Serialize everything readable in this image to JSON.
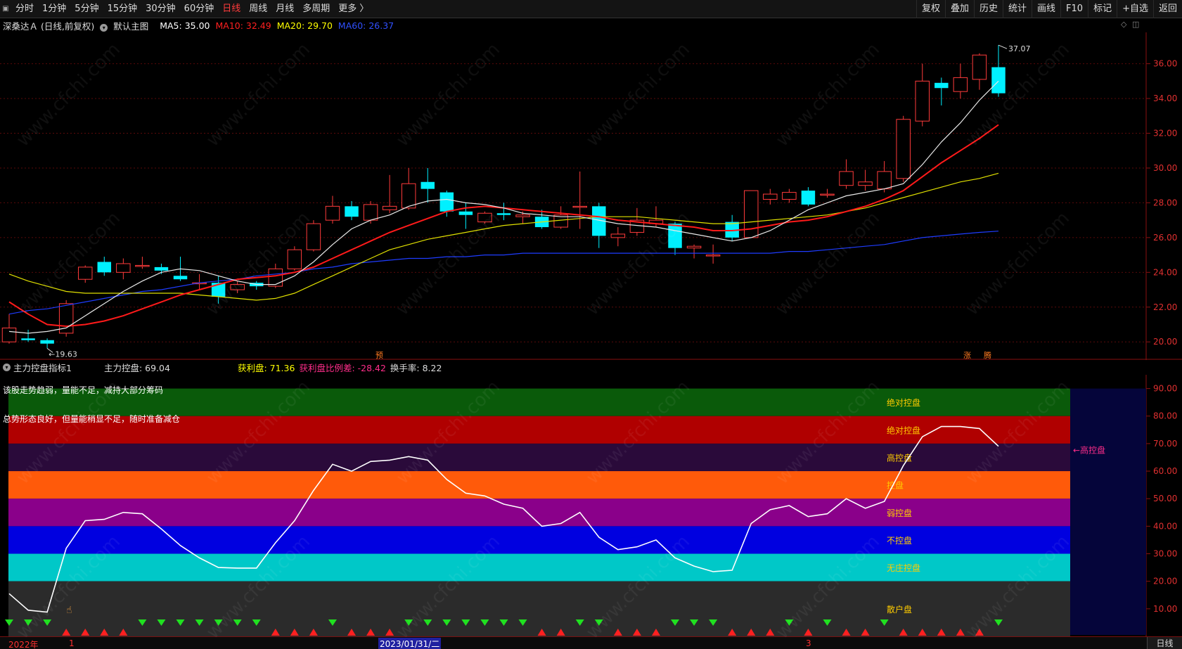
{
  "toolbar": {
    "left_items": [
      "分时",
      "1分钟",
      "5分钟",
      "15分钟",
      "30分钟",
      "60分钟",
      "日线",
      "周线",
      "月线",
      "多周期",
      "更多 〉"
    ],
    "active_index": 6,
    "right_items": [
      "复权",
      "叠加",
      "历史",
      "统计",
      "画线",
      "F10",
      "标记",
      "+自选",
      "返回"
    ]
  },
  "info": {
    "stock": "深桑达Ａ (日线,前复权)",
    "main_chart": "默认主图",
    "ma5": "MA5: 35.00",
    "ma10": "MA10: 32.49",
    "ma20": "MA20: 29.70",
    "ma60": "MA60: 26.37"
  },
  "chart_data": {
    "type": "candlestick",
    "y_ticks": [
      "36.00",
      "34.00",
      "32.00",
      "30.00",
      "28.00",
      "26.00",
      "24.00",
      "22.00",
      "20.00"
    ],
    "ylim": [
      19.2,
      37.4
    ],
    "high_label": "37.07",
    "low_label": "19.63",
    "markers": {
      "yu": "预",
      "zhang": "涨",
      "teng": "腾"
    },
    "candles": [
      {
        "o": 20.0,
        "h": 21.6,
        "l": 19.9,
        "c": 20.8
      },
      {
        "o": 20.2,
        "h": 20.7,
        "l": 20.0,
        "c": 20.1
      },
      {
        "o": 20.1,
        "h": 20.2,
        "l": 19.63,
        "c": 19.9
      },
      {
        "o": 20.5,
        "h": 22.4,
        "l": 20.3,
        "c": 22.2
      },
      {
        "o": 23.6,
        "h": 24.4,
        "l": 23.4,
        "c": 24.3
      },
      {
        "o": 24.6,
        "h": 24.9,
        "l": 23.8,
        "c": 24.0
      },
      {
        "o": 24.0,
        "h": 24.8,
        "l": 23.6,
        "c": 24.5
      },
      {
        "o": 24.4,
        "h": 24.9,
        "l": 24.2,
        "c": 24.4
      },
      {
        "o": 24.3,
        "h": 24.5,
        "l": 23.9,
        "c": 24.1
      },
      {
        "o": 23.8,
        "h": 24.9,
        "l": 23.5,
        "c": 23.6
      },
      {
        "o": 23.4,
        "h": 23.9,
        "l": 23.0,
        "c": 23.4
      },
      {
        "o": 23.4,
        "h": 23.8,
        "l": 22.2,
        "c": 22.6
      },
      {
        "o": 23.0,
        "h": 23.5,
        "l": 22.8,
        "c": 23.3
      },
      {
        "o": 23.4,
        "h": 23.5,
        "l": 23.0,
        "c": 23.2
      },
      {
        "o": 23.2,
        "h": 24.5,
        "l": 23.1,
        "c": 24.2
      },
      {
        "o": 24.2,
        "h": 25.5,
        "l": 24.1,
        "c": 25.3
      },
      {
        "o": 25.3,
        "h": 27.0,
        "l": 25.2,
        "c": 26.8
      },
      {
        "o": 27.0,
        "h": 28.4,
        "l": 26.8,
        "c": 27.8
      },
      {
        "o": 27.8,
        "h": 28.1,
        "l": 27.0,
        "c": 27.2
      },
      {
        "o": 27.0,
        "h": 28.1,
        "l": 26.8,
        "c": 27.9
      },
      {
        "o": 27.6,
        "h": 29.6,
        "l": 27.4,
        "c": 27.8
      },
      {
        "o": 27.7,
        "h": 30.0,
        "l": 27.6,
        "c": 29.1
      },
      {
        "o": 29.2,
        "h": 30.0,
        "l": 28.0,
        "c": 28.8
      },
      {
        "o": 28.6,
        "h": 28.7,
        "l": 27.2,
        "c": 27.5
      },
      {
        "o": 27.5,
        "h": 28.0,
        "l": 26.5,
        "c": 27.3
      },
      {
        "o": 26.9,
        "h": 27.5,
        "l": 26.8,
        "c": 27.4
      },
      {
        "o": 27.4,
        "h": 28.0,
        "l": 27.0,
        "c": 27.3
      },
      {
        "o": 27.2,
        "h": 27.5,
        "l": 26.8,
        "c": 27.3
      },
      {
        "o": 27.2,
        "h": 27.6,
        "l": 26.5,
        "c": 26.6
      },
      {
        "o": 26.6,
        "h": 27.8,
        "l": 26.5,
        "c": 27.3
      },
      {
        "o": 27.8,
        "h": 29.8,
        "l": 26.5,
        "c": 27.8
      },
      {
        "o": 27.8,
        "h": 28.0,
        "l": 25.4,
        "c": 26.1
      },
      {
        "o": 26.0,
        "h": 26.6,
        "l": 25.5,
        "c": 26.2
      },
      {
        "o": 26.3,
        "h": 27.7,
        "l": 26.1,
        "c": 27.0
      },
      {
        "o": 26.8,
        "h": 27.8,
        "l": 26.6,
        "c": 27.0
      },
      {
        "o": 26.8,
        "h": 26.9,
        "l": 25.0,
        "c": 25.4
      },
      {
        "o": 25.4,
        "h": 25.6,
        "l": 24.8,
        "c": 25.5
      },
      {
        "o": 25.0,
        "h": 25.6,
        "l": 24.5,
        "c": 25.0
      },
      {
        "o": 26.9,
        "h": 27.3,
        "l": 25.8,
        "c": 26.0
      },
      {
        "o": 26.0,
        "h": 28.7,
        "l": 26.0,
        "c": 28.7
      },
      {
        "o": 28.2,
        "h": 28.8,
        "l": 27.9,
        "c": 28.5
      },
      {
        "o": 28.2,
        "h": 28.8,
        "l": 28.0,
        "c": 28.6
      },
      {
        "o": 28.7,
        "h": 28.9,
        "l": 27.8,
        "c": 27.9
      },
      {
        "o": 28.5,
        "h": 28.8,
        "l": 28.3,
        "c": 28.5
      },
      {
        "o": 29.0,
        "h": 30.5,
        "l": 28.8,
        "c": 29.8
      },
      {
        "o": 29.0,
        "h": 29.9,
        "l": 28.7,
        "c": 29.2
      },
      {
        "o": 28.8,
        "h": 30.4,
        "l": 28.6,
        "c": 29.8
      },
      {
        "o": 29.4,
        "h": 33.0,
        "l": 29.2,
        "c": 32.8
      },
      {
        "o": 32.7,
        "h": 36.0,
        "l": 32.4,
        "c": 35.0
      },
      {
        "o": 34.9,
        "h": 35.2,
        "l": 33.6,
        "c": 34.6
      },
      {
        "o": 34.4,
        "h": 36.0,
        "l": 34.0,
        "c": 35.2
      },
      {
        "o": 35.1,
        "h": 36.6,
        "l": 34.5,
        "c": 36.5
      },
      {
        "o": 35.8,
        "h": 37.07,
        "l": 34.1,
        "c": 34.3
      }
    ],
    "ma5": [
      20.6,
      20.5,
      20.6,
      20.8,
      21.5,
      22.2,
      22.9,
      23.5,
      24.0,
      24.2,
      24.1,
      23.8,
      23.5,
      23.3,
      23.3,
      23.8,
      24.6,
      25.6,
      26.5,
      27.0,
      27.3,
      27.8,
      28.1,
      28.2,
      28.0,
      27.9,
      27.7,
      27.4,
      27.3,
      27.2,
      27.2,
      27.0,
      26.8,
      26.7,
      26.6,
      26.4,
      26.2,
      26.0,
      25.8,
      26.0,
      26.4,
      27.0,
      27.6,
      28.0,
      28.4,
      28.6,
      28.8,
      29.1,
      30.2,
      31.5,
      32.6,
      33.9,
      35.0
    ],
    "ma10": [
      22.3,
      21.6,
      21.0,
      20.9,
      21.0,
      21.2,
      21.5,
      21.9,
      22.3,
      22.7,
      23.0,
      23.3,
      23.6,
      23.7,
      23.8,
      24.0,
      24.3,
      24.8,
      25.3,
      25.8,
      26.3,
      26.7,
      27.1,
      27.5,
      27.7,
      27.8,
      27.7,
      27.6,
      27.5,
      27.4,
      27.3,
      27.2,
      27.0,
      26.9,
      26.8,
      26.7,
      26.6,
      26.4,
      26.4,
      26.5,
      26.7,
      26.9,
      27.0,
      27.2,
      27.5,
      27.8,
      28.2,
      28.7,
      29.5,
      30.3,
      31.0,
      31.7,
      32.49
    ],
    "ma20": [
      23.9,
      23.5,
      23.2,
      22.9,
      22.8,
      22.8,
      22.8,
      22.8,
      22.8,
      22.8,
      22.7,
      22.6,
      22.5,
      22.4,
      22.5,
      22.8,
      23.3,
      23.8,
      24.3,
      24.8,
      25.3,
      25.6,
      25.9,
      26.1,
      26.3,
      26.5,
      26.7,
      26.8,
      26.9,
      27.0,
      27.1,
      27.2,
      27.2,
      27.2,
      27.1,
      27.0,
      26.9,
      26.8,
      26.8,
      26.9,
      27.0,
      27.1,
      27.2,
      27.3,
      27.5,
      27.7,
      28.0,
      28.3,
      28.6,
      28.9,
      29.2,
      29.4,
      29.7
    ],
    "ma60": [
      21.6,
      21.8,
      21.9,
      22.1,
      22.3,
      22.5,
      22.7,
      22.9,
      23.0,
      23.2,
      23.4,
      23.5,
      23.6,
      23.8,
      23.9,
      24.0,
      24.2,
      24.3,
      24.5,
      24.6,
      24.7,
      24.8,
      24.8,
      24.9,
      24.9,
      25.0,
      25.0,
      25.1,
      25.1,
      25.1,
      25.1,
      25.1,
      25.1,
      25.1,
      25.1,
      25.1,
      25.1,
      25.1,
      25.1,
      25.1,
      25.1,
      25.2,
      25.2,
      25.3,
      25.4,
      25.5,
      25.6,
      25.8,
      26.0,
      26.1,
      26.2,
      26.3,
      26.37
    ]
  },
  "indicator": {
    "name": "主力控盘指标1",
    "control_label": "主力控盘: 69.04",
    "profit_label": "获利盘: 71.36",
    "profit_diff_label": "获利盘比例差: -28.42",
    "turnover_label": "换手率: 8.22",
    "message1": "该股走势趋弱，量能不足，减持大部分筹码",
    "message2": "总势形态良好，但量能稍显不足，随时准备减仓",
    "y_ticks": [
      "90.00",
      "80.00",
      "70.00",
      "60.00",
      "50.00",
      "40.00",
      "30.00",
      "20.00",
      "10.00"
    ],
    "ylim": [
      0,
      95
    ],
    "bands": [
      {
        "from": 80,
        "to": 90,
        "color": "#0a5a0a",
        "label": "绝对控盘",
        "label_color": "#ffcc00"
      },
      {
        "from": 70,
        "to": 80,
        "color": "#b00000",
        "label": "绝对控盘",
        "label_color": "#ffcc00"
      },
      {
        "from": 60,
        "to": 70,
        "color": "#2a0a3a",
        "label": "高控盘",
        "label_color": "#ffcc00"
      },
      {
        "from": 50,
        "to": 60,
        "color": "#ff5a0a",
        "label": "控盘",
        "label_color": "#ffcc00"
      },
      {
        "from": 40,
        "to": 50,
        "color": "#8a008a",
        "label": "弱控盘",
        "label_color": "#ffcc00"
      },
      {
        "from": 30,
        "to": 40,
        "color": "#0000e0",
        "label": "不控盘",
        "label_color": "#ffcc00"
      },
      {
        "from": 20,
        "to": 30,
        "color": "#00c8c8",
        "label": "无庄控盘",
        "label_color": "#ffcc00"
      },
      {
        "from": 0,
        "to": 20,
        "color": "#2b2b2b",
        "label": "散户盘",
        "label_color": "#ffcc00"
      }
    ],
    "current_label": "高控盘",
    "values": [
      15.5,
      9.5,
      8.8,
      32,
      42,
      42.5,
      45,
      44.5,
      39,
      33,
      28.5,
      25,
      24.8,
      24.8,
      34,
      42,
      53,
      62.5,
      60,
      63.5,
      64,
      65.3,
      64,
      57,
      52,
      51,
      48,
      46.5,
      40,
      41,
      45,
      36,
      31.5,
      32.5,
      35,
      28.5,
      25.5,
      23.5,
      24,
      41,
      46,
      47.5,
      43.5,
      44.5,
      50,
      46.5,
      49,
      62,
      72.5,
      76.2,
      76.2,
      75.5,
      69.04
    ],
    "signals": [
      "g",
      "g",
      "g",
      "r",
      "r",
      "r",
      "r",
      "g",
      "g",
      "g",
      "g",
      "g",
      "g",
      "g",
      "r",
      "r",
      "r",
      "g",
      "r",
      "r",
      "r",
      "g",
      "g",
      "g",
      "g",
      "g",
      "g",
      "g",
      "r",
      "r",
      "g",
      "g",
      "r",
      "r",
      "r",
      "g",
      "g",
      "g",
      "r",
      "r",
      "r",
      "g",
      "r",
      "g",
      "r",
      "r",
      "g",
      "r",
      "r",
      "r",
      "r",
      "r",
      "g"
    ]
  },
  "bottom": {
    "year_label": "2022年",
    "month1": "1",
    "date_label": "2023/01/31/二",
    "month3": "3",
    "tab": "日线"
  }
}
